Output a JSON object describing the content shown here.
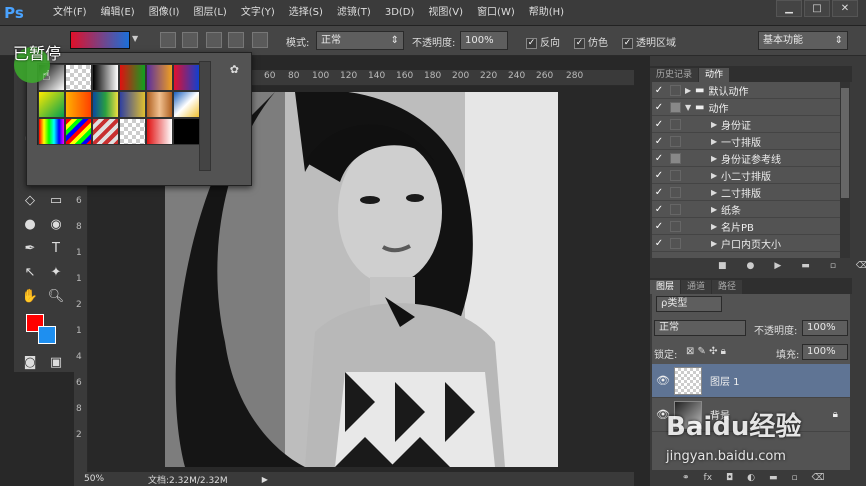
{
  "app": {
    "logo": "Ps"
  },
  "menu": [
    "文件(F)",
    "编辑(E)",
    "图像(I)",
    "图层(L)",
    "文字(Y)",
    "选择(S)",
    "滤镜(T)",
    "3D(D)",
    "视图(V)",
    "窗口(W)",
    "帮助(H)"
  ],
  "window_controls": [
    "▁",
    "□",
    "✕"
  ],
  "options": {
    "mode_label": "模式:",
    "mode_value": "正常",
    "opacity_label": "不透明度:",
    "opacity_value": "100%",
    "reverse_label": "反向",
    "dither_label": "仿色",
    "transparency_label": "透明区域",
    "workspace_value": "基本功能"
  },
  "overlay": {
    "paused_text": "已暂停"
  },
  "ruler": {
    "h_ticks": [
      "60",
      "80",
      "100",
      "120",
      "140",
      "160",
      "180",
      "200",
      "220",
      "240",
      "260",
      "280"
    ],
    "v_ticks": [
      "1",
      "2",
      "4",
      "6",
      "8",
      "1",
      "1",
      "2",
      "1",
      "4",
      "6",
      "8",
      "2",
      "2",
      "2"
    ]
  },
  "status": {
    "zoom": "50%",
    "doc_info": "文档:2.32M/2.32M"
  },
  "history_panel": {
    "tabs": [
      "历史记录",
      "动作"
    ],
    "actions": [
      {
        "name": "默认动作",
        "type": "set",
        "expanded": false
      },
      {
        "name": "动作",
        "type": "set",
        "expanded": true
      },
      {
        "name": "身份证",
        "type": "action"
      },
      {
        "name": "一寸排版",
        "type": "action"
      },
      {
        "name": "身份证参考线",
        "type": "action"
      },
      {
        "name": "小二寸排版",
        "type": "action"
      },
      {
        "name": "二寸排版",
        "type": "action"
      },
      {
        "name": "纸条",
        "type": "action"
      },
      {
        "name": "名片PB",
        "type": "action"
      },
      {
        "name": "户口内页大小",
        "type": "action"
      }
    ]
  },
  "layers_panel": {
    "tabs": [
      "图层",
      "通道",
      "路径"
    ],
    "filter_label": "ρ类型",
    "blend_mode": "正常",
    "opacity_label": "不透明度:",
    "opacity_value": "100%",
    "lock_label": "锁定:",
    "fill_label": "填充:",
    "fill_value": "100%",
    "layers": [
      {
        "name": "图层 1",
        "selected": true
      },
      {
        "name": "背景",
        "selected": false
      }
    ]
  },
  "watermark": {
    "logo": "Baidu经验",
    "url": "jingyan.baidu.com"
  },
  "colors": {
    "foreground": "#ff0000",
    "background": "#1e8ff0",
    "accent": "#4aa3ff",
    "selected_layer": "#5f7494"
  }
}
